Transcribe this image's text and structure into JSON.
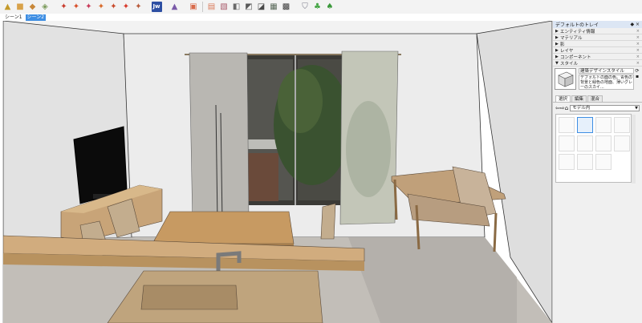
{
  "toolbar": {
    "buttons": [
      "select-tool-icon",
      "component-icon",
      "component-3d-icon",
      "sandbox-icon",
      "plugin-icon",
      "plugin-icon",
      "plugin-icon",
      "plugin-icon",
      "plugin-icon",
      "plugin-icon",
      "jw-cad-icon",
      "ruby-icon",
      "frame-icon",
      "section-icon",
      "texture-icon",
      "texture-icon",
      "texture-icon",
      "texture-icon",
      "texture-icon",
      "shield-icon",
      "tree-icon",
      "tree-icon"
    ],
    "jw_label": "Jw"
  },
  "scenes": [
    {
      "label": "シーン1",
      "active": false
    },
    {
      "label": "シーン2",
      "active": true
    }
  ],
  "tray": {
    "title": "デフォルトのトレイ",
    "sections": [
      {
        "label": "エンティティ情報",
        "expanded": false
      },
      {
        "label": "マテリアル",
        "expanded": false
      },
      {
        "label": "影",
        "expanded": false
      },
      {
        "label": "レイヤ",
        "expanded": false
      },
      {
        "label": "コンポーネント",
        "expanded": false
      },
      {
        "label": "スタイル",
        "expanded": true
      }
    ],
    "style_name": "建築デザインスタイル",
    "style_desc": "デフォルトの面の色。青色の背景と緑色の地面、薄いグレーのスカイ...",
    "tabs": [
      {
        "label": "選択",
        "active": true
      },
      {
        "label": "編集",
        "active": false
      },
      {
        "label": "混合",
        "active": false
      }
    ],
    "library": "モデル内"
  },
  "colors": {
    "accent": "#3e8ee3",
    "wall": "#ebebeb",
    "floor": "#b9b5b0",
    "wood": "#c09a6b"
  }
}
